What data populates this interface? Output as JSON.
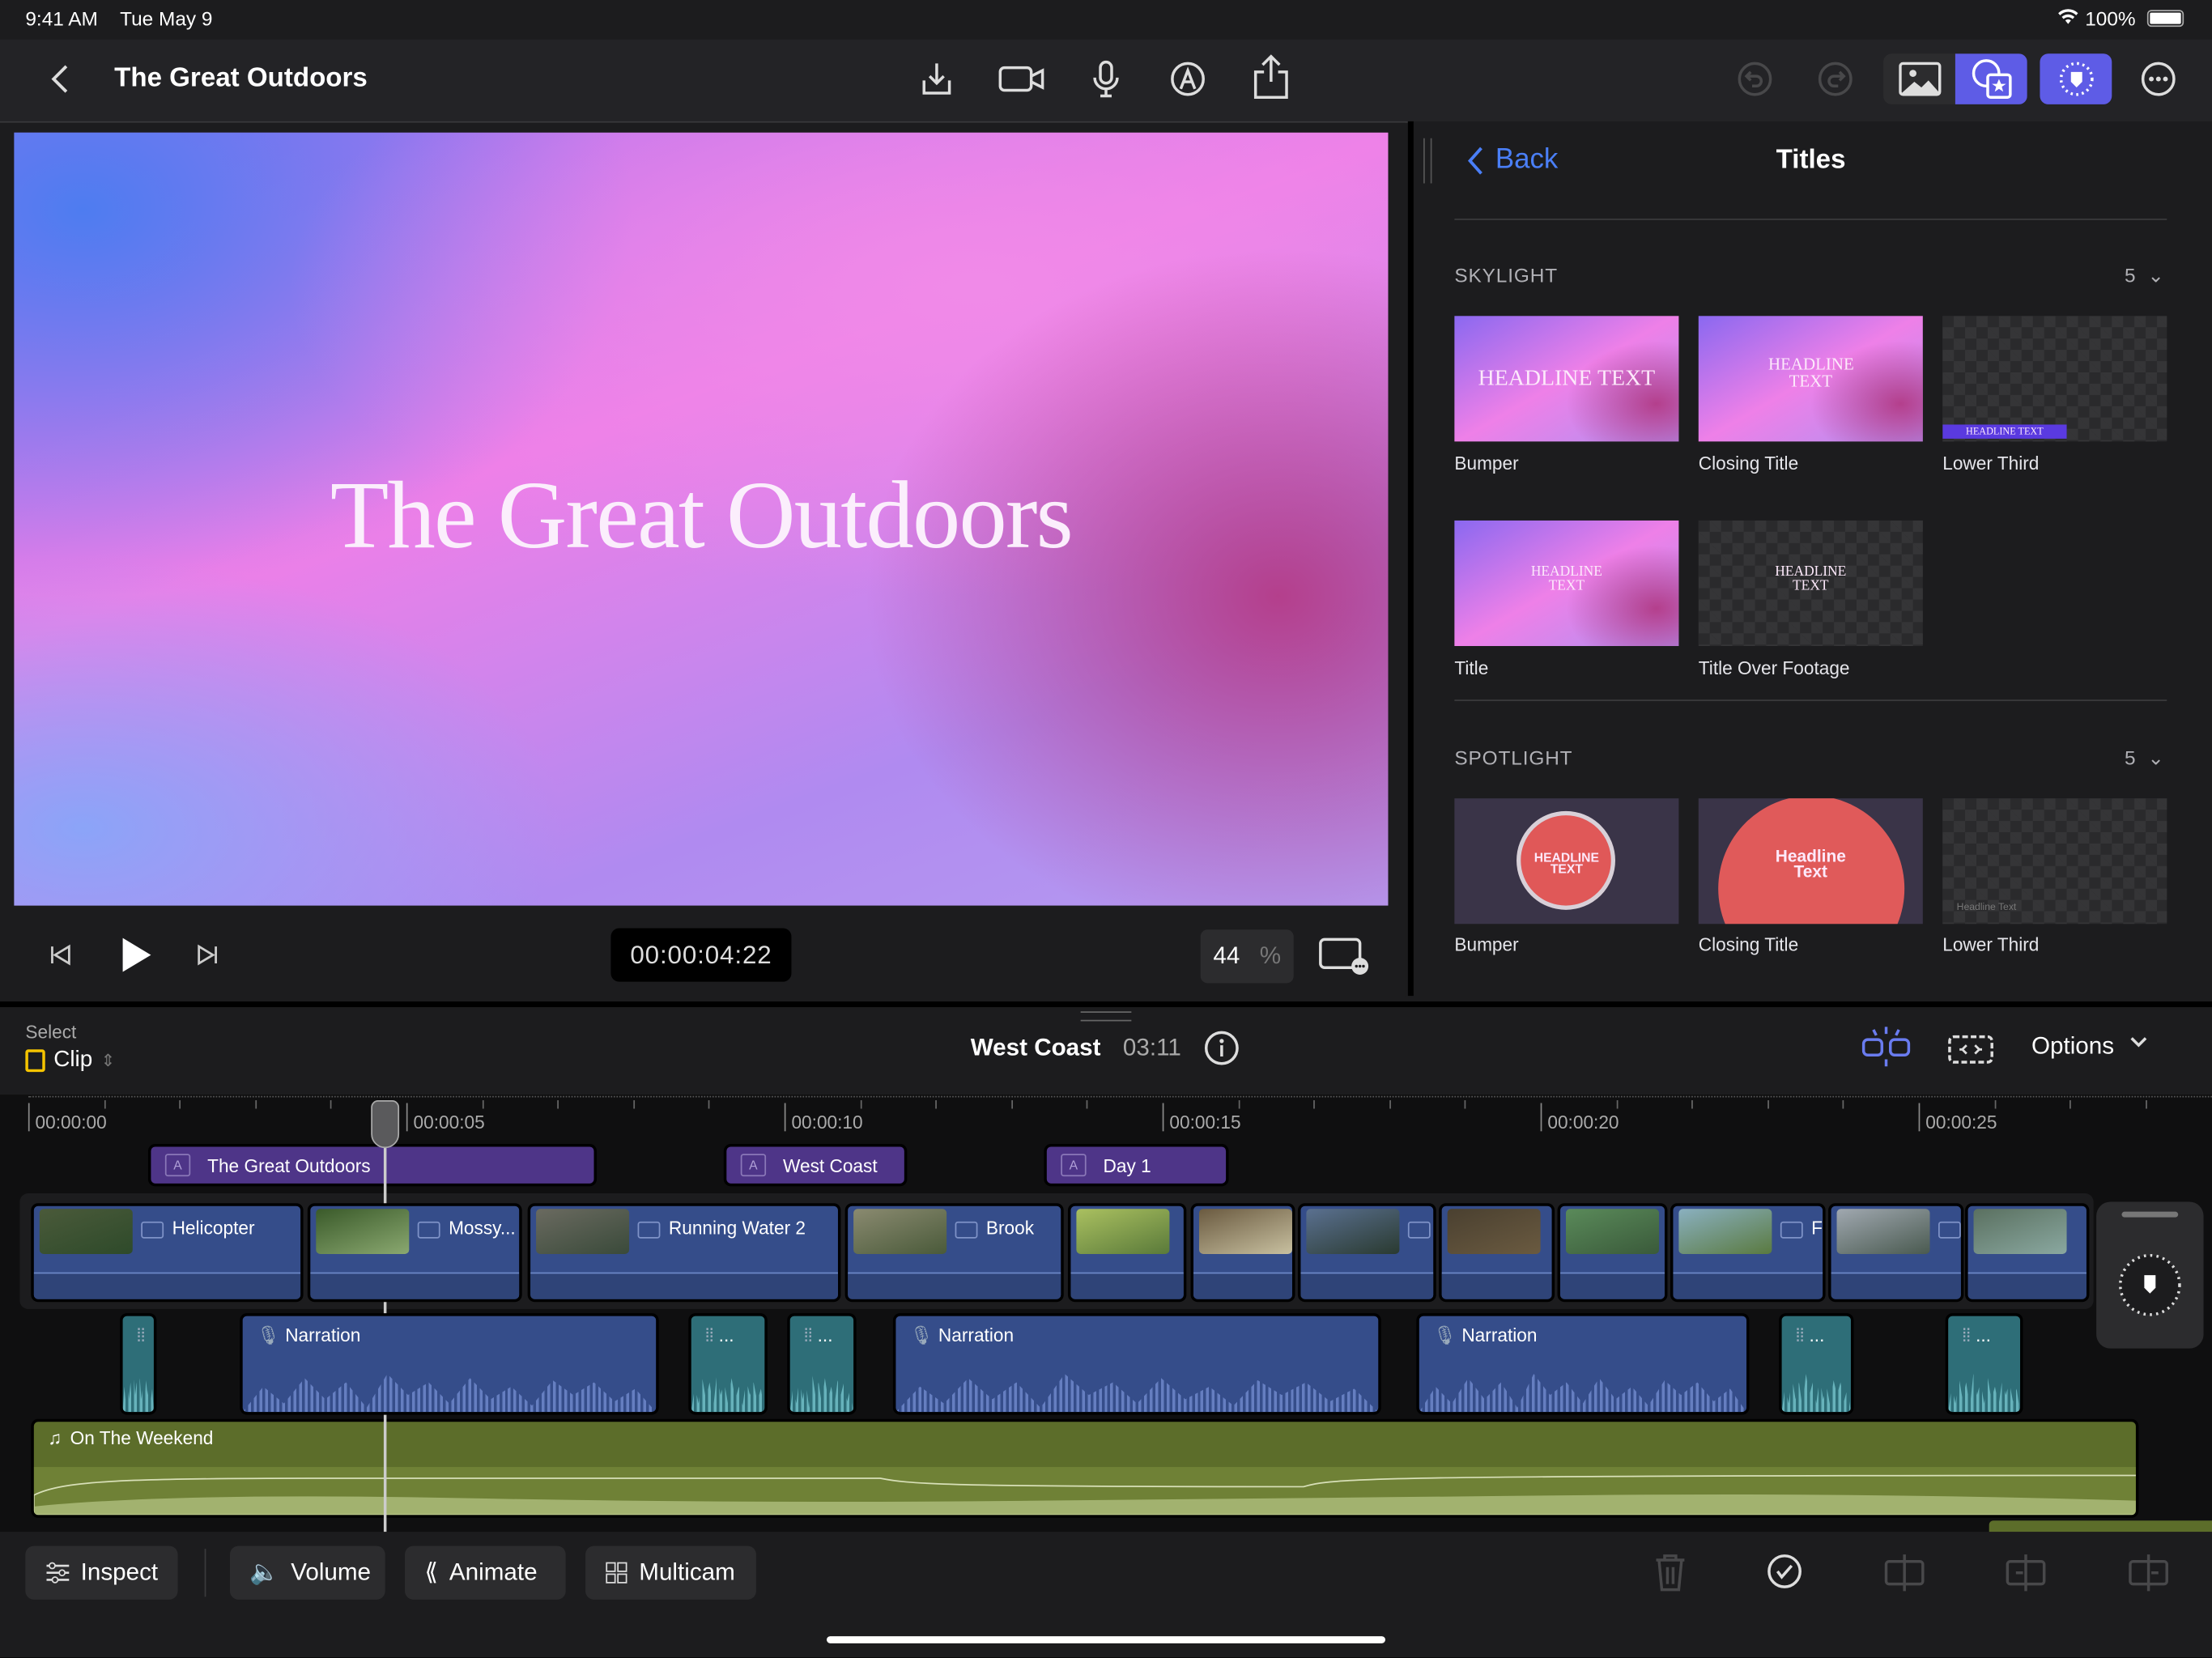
{
  "status": {
    "time": "9:41 AM",
    "date": "Tue May 9",
    "battery": "100%"
  },
  "header": {
    "title": "The Great Outdoors",
    "icons": [
      "back-chevron",
      "import",
      "camera",
      "microphone",
      "voiceover",
      "share",
      "undo",
      "redo",
      "photos",
      "titles-effects",
      "inspector-badge",
      "more"
    ]
  },
  "viewer": {
    "title_text": "The Great Outdoors",
    "timecode": "00:00:04:22",
    "zoom": "44",
    "zoom_unit": "%"
  },
  "browser": {
    "back_label": "Back",
    "title": "Titles",
    "sections": [
      {
        "name": "SKYLIGHT",
        "count": "5",
        "items": [
          {
            "label": "Bumper",
            "thumb_text": "HEADLINE TEXT"
          },
          {
            "label": "Closing Title",
            "thumb_text": "HEADLINE TEXT"
          },
          {
            "label": "Lower Third",
            "thumb_text": "HEADLINE TEXT"
          },
          {
            "label": "Title",
            "thumb_text": "HEADLINE TEXT"
          },
          {
            "label": "Title Over Footage",
            "thumb_text": "HEADLINE TEXT"
          }
        ]
      },
      {
        "name": "SPOTLIGHT",
        "count": "5",
        "items": [
          {
            "label": "Bumper",
            "thumb_text": "HEADLINE TEXT"
          },
          {
            "label": "Closing Title",
            "thumb_text": "Headline Text"
          },
          {
            "label": "Lower Third",
            "thumb_text": "Headline Text"
          }
        ]
      }
    ]
  },
  "timeline": {
    "select_label": "Select",
    "mode": "Clip",
    "project": "West Coast",
    "duration": "03:11",
    "options_label": "Options",
    "ruler": [
      "00:00:00",
      "00:00:05",
      "00:00:10",
      "00:00:15",
      "00:00:20",
      "00:00:25"
    ],
    "titles": [
      "The Great Outdoors",
      "West Coast",
      "Day 1"
    ],
    "video_clips": [
      "Helicopter",
      "Mossy...",
      "Running Water 2",
      "Brook",
      "",
      "",
      "",
      "",
      "",
      "F",
      "",
      ""
    ],
    "audio_clips": [
      "",
      "Narration",
      "...",
      "...",
      "Narration",
      "Narration",
      "...",
      "..."
    ],
    "music": "On The Weekend"
  },
  "toolbar": {
    "inspect": "Inspect",
    "volume": "Volume",
    "animate": "Animate",
    "multicam": "Multicam"
  },
  "colors": {
    "accent": "#5e5ce6",
    "title_clip": "#4e3588",
    "video_clip": "#354d8a",
    "music_clip": "#5c6d2a",
    "link_blue": "#4a7ff7"
  }
}
